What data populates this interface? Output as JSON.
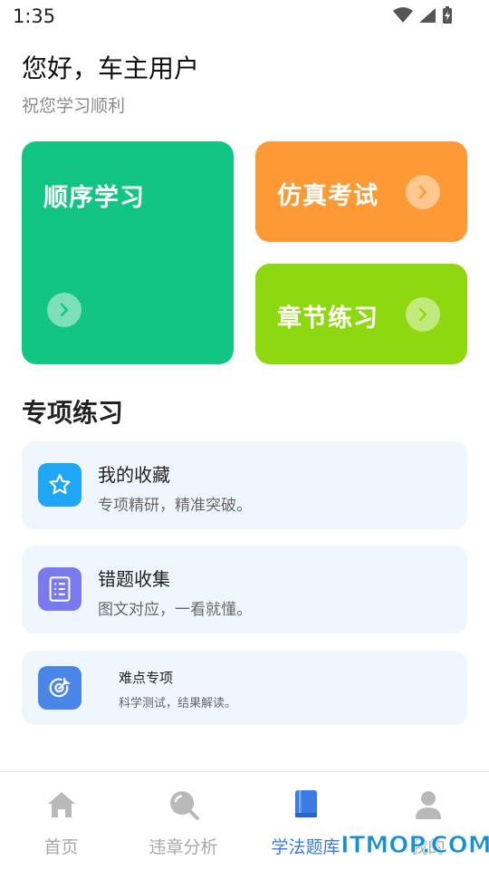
{
  "status_bar": {
    "time": "1:35"
  },
  "header": {
    "greeting": "您好，车主用户",
    "subtitle": "祝您学习顺利"
  },
  "cards": {
    "order_study": {
      "title": "顺序学习",
      "color": "#13c583"
    },
    "mock_exam": {
      "title": "仿真考试",
      "color": "#fd9a36"
    },
    "chapter_practice": {
      "title": "章节练习",
      "color": "#8ed80f"
    }
  },
  "special": {
    "section_title": "专项练习",
    "items": [
      {
        "title": "我的收藏",
        "desc": "专项精研，精准突破。",
        "icon": "star-icon",
        "color": "#1fa6f5"
      },
      {
        "title": "错题收集",
        "desc": "图文对应，一看就懂。",
        "icon": "list-icon",
        "color": "#7a7af0"
      },
      {
        "title": "难点专项",
        "desc": "科学测试，结果解读。",
        "icon": "target-icon",
        "color": "#4a86e8"
      }
    ]
  },
  "bottom_nav": {
    "items": [
      {
        "label": "首页",
        "icon": "home-icon"
      },
      {
        "label": "违章分析",
        "icon": "search-icon"
      },
      {
        "label": "学法题库",
        "icon": "book-icon",
        "active": true
      },
      {
        "label": "我的",
        "icon": "user-icon"
      }
    ],
    "active_color": "#3a7be6"
  },
  "watermark": "ITMOP.COM"
}
